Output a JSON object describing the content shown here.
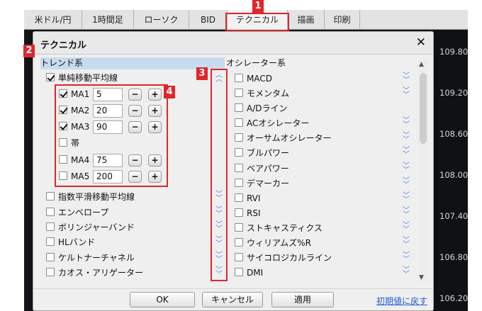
{
  "toolbar": {
    "items": [
      {
        "label": "米ドル/円"
      },
      {
        "label": "1時間足"
      },
      {
        "label": "ローソク"
      },
      {
        "label": "BID"
      },
      {
        "label": "テクニカル"
      },
      {
        "label": "描画"
      },
      {
        "label": "印刷"
      }
    ]
  },
  "prices": [
    "109.80",
    "109.20",
    "108.60",
    "108.00",
    "107.40",
    "106.80",
    "106.20"
  ],
  "dialog": {
    "title": "テクニカル",
    "close_symbol": "✕",
    "trend": {
      "header": "トレンド系",
      "sma": {
        "label": "単純移動平均線",
        "checked": true
      },
      "ma_lines": [
        {
          "label": "MA1",
          "value": "5",
          "checked": true
        },
        {
          "label": "MA2",
          "value": "20",
          "checked": true
        },
        {
          "label": "MA3",
          "value": "90",
          "checked": true
        },
        {
          "label": "帯",
          "checked": false
        },
        {
          "label": "MA4",
          "value": "75",
          "checked": false
        },
        {
          "label": "MA5",
          "value": "200",
          "checked": false
        }
      ],
      "stepper": {
        "minus": "−",
        "plus": "+"
      },
      "items": [
        {
          "label": "指数平滑移動平均線"
        },
        {
          "label": "エンベロープ"
        },
        {
          "label": "ボリンジャーバンド"
        },
        {
          "label": "HLバンド"
        },
        {
          "label": "ケルトナーチャネル"
        },
        {
          "label": "カオス・アリゲーター"
        }
      ]
    },
    "oscillator": {
      "header": "オシレーター系",
      "items": [
        {
          "label": "MACD"
        },
        {
          "label": "モメンタム"
        },
        {
          "label": "A/Dライン"
        },
        {
          "label": "ACオシレーター"
        },
        {
          "label": "オーサムオシレーター"
        },
        {
          "label": "ブルパワー"
        },
        {
          "label": "ベアパワー"
        },
        {
          "label": "デマーカー"
        },
        {
          "label": "RVI"
        },
        {
          "label": "RSI"
        },
        {
          "label": "ストキャスティクス"
        },
        {
          "label": "ウィリアムズ%R"
        },
        {
          "label": "サイコロジカルライン"
        },
        {
          "label": "DMI"
        }
      ]
    },
    "buttons": {
      "ok": "OK",
      "cancel": "キャンセル",
      "apply": "適用"
    },
    "reset_link": "初期値に戻す"
  },
  "annotations": [
    "1",
    "2",
    "3",
    "4"
  ],
  "colors": {
    "accent_red": "#e0262b",
    "link_blue": "#2a5bd7",
    "chevron_blue": "#3b7de0",
    "header_blue": "#c8dcf0"
  }
}
